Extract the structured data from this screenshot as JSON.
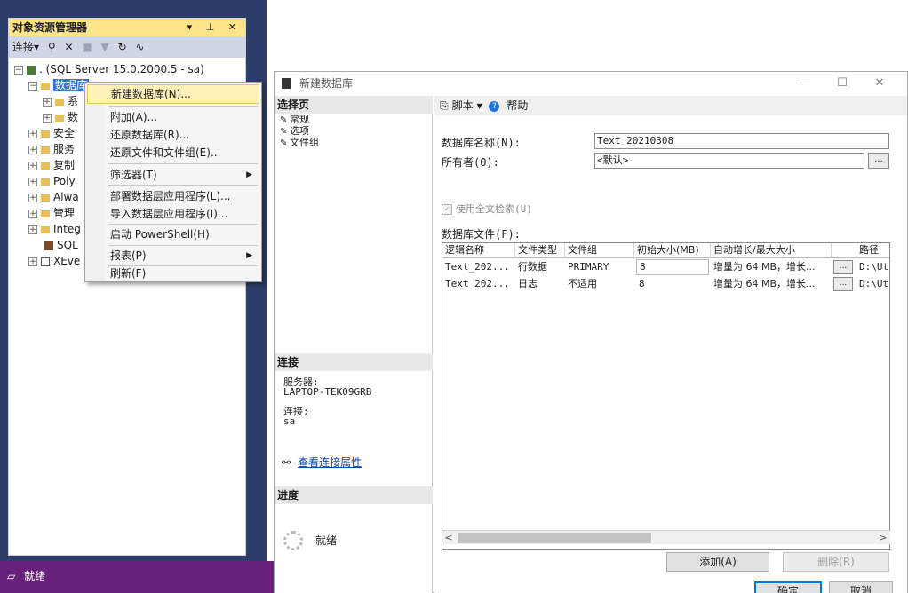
{
  "object_explorer": {
    "title": "对象资源管理器",
    "title_icons": "▾ ⊥ ✕",
    "toolbar": {
      "connect_label": "连接▾",
      "icons": [
        "connect-icon",
        "disconnect-icon",
        "stop-icon",
        "filter-icon",
        "refresh-icon",
        "activity-icon"
      ]
    },
    "tree": {
      "server": ". (SQL Server 15.0.2000.5 - sa)",
      "items": [
        {
          "label": "数据库",
          "selected": true
        },
        {
          "label": "系"
        },
        {
          "label": "数"
        },
        {
          "label": "安全"
        },
        {
          "label": "服务"
        },
        {
          "label": "复制"
        },
        {
          "label": "Poly"
        },
        {
          "label": "Alwa"
        },
        {
          "label": "管理"
        },
        {
          "label": "Integ"
        },
        {
          "label": "SQL"
        },
        {
          "label": "XEve"
        }
      ]
    }
  },
  "context_menu": {
    "items": [
      {
        "label": "新建数据库(N)...",
        "highlight": true
      },
      {
        "label": "附加(A)..."
      },
      {
        "label": "还原数据库(R)..."
      },
      {
        "label": "还原文件和文件组(E)..."
      },
      {
        "label": "筛选器(T)",
        "submenu": true
      },
      {
        "label": "部署数据层应用程序(L)..."
      },
      {
        "label": "导入数据层应用程序(I)..."
      },
      {
        "label": "启动 PowerShell(H)"
      },
      {
        "label": "报表(P)",
        "submenu": true
      },
      {
        "label": "刷新(F)"
      }
    ]
  },
  "status_bar": {
    "text": "就绪"
  },
  "dialog": {
    "title": "新建数据库",
    "window_controls": {
      "minimize": "—",
      "maximize": "☐",
      "close": "✕"
    },
    "select_page": {
      "header": "选择页",
      "pages": [
        "常规",
        "选项",
        "文件组"
      ]
    },
    "connection": {
      "header": "连接",
      "server_label": "服务器:",
      "server_value": "LAPTOP-TEK09GRB",
      "conn_label": "连接:",
      "conn_value": "sa",
      "view_props_link": "查看连接属性"
    },
    "progress": {
      "header": "进度",
      "status": "就绪"
    },
    "toolbar": {
      "script_label": "脚本",
      "help_label": "帮助"
    },
    "form": {
      "db_name_label": "数据库名称(N):",
      "db_name_value": "Text_20210308",
      "owner_label": "所有者(O):",
      "owner_value": "<默认>",
      "browse_label": "...",
      "fulltext_label": "使用全文检索(U)",
      "files_label": "数据库文件(F):"
    },
    "files_grid": {
      "columns": [
        "逻辑名称",
        "文件类型",
        "文件组",
        "初始大小(MB)",
        "自动增长/最大大小",
        "",
        "路径"
      ],
      "rows": [
        {
          "name": "Text_202...",
          "type": "行数据",
          "filegroup": "PRIMARY",
          "size": "8",
          "growth": "增量为 64 MB，增长...",
          "browse": "...",
          "path": "D:\\Ut"
        },
        {
          "name": "Text_202...",
          "type": "日志",
          "filegroup": "不适用",
          "size": "8",
          "growth": "增量为 64 MB，增长...",
          "browse": "...",
          "path": "D:\\Ut"
        }
      ]
    },
    "buttons": {
      "add": "添加(A)",
      "remove": "删除(R)",
      "ok": "确定",
      "cancel": "取消"
    },
    "scroll": {
      "left": "<",
      "right": ">"
    }
  }
}
